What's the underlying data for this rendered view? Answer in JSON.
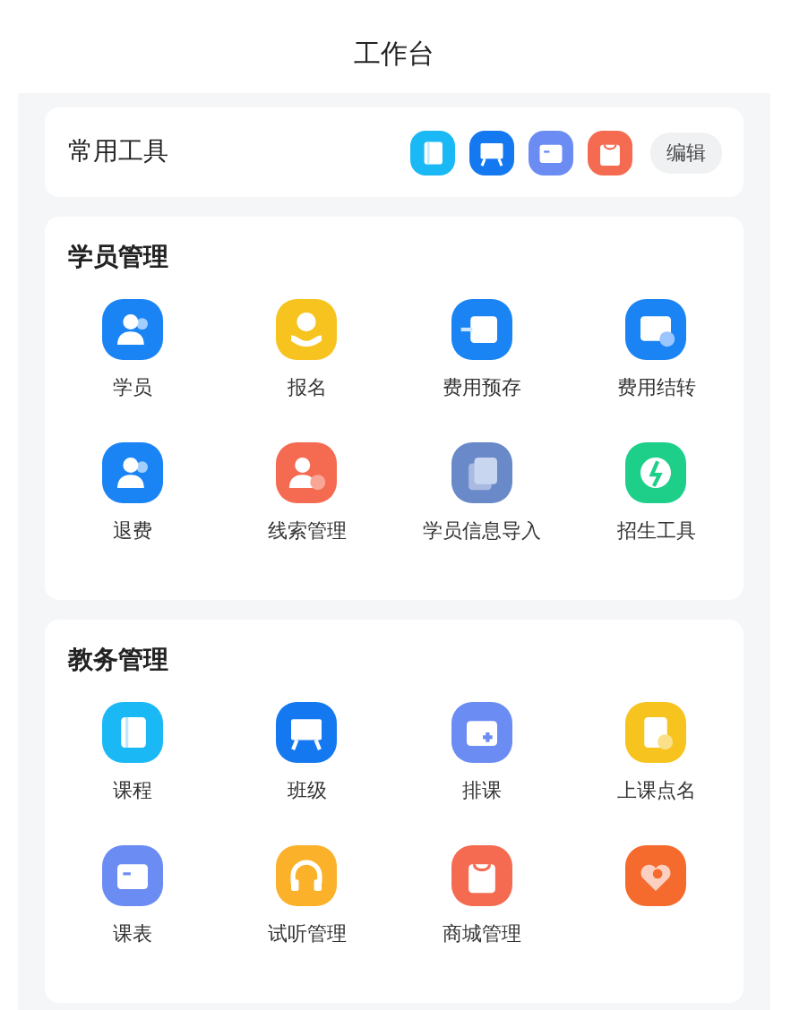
{
  "nav_bar": {
    "title": "工作台"
  },
  "quick_tools": {
    "title": "常用工具",
    "edit_button": "编辑",
    "tools": [
      {
        "kind": "book",
        "color": "#1ab8f5"
      },
      {
        "kind": "board",
        "color": "#1479f0"
      },
      {
        "kind": "calendar",
        "color": "#6b8cf2"
      },
      {
        "kind": "bag",
        "color": "#f56b52"
      }
    ]
  },
  "sections": [
    {
      "title": "学员管理",
      "items": [
        {
          "label": "学员",
          "kind": "person",
          "color": "#1a84f5"
        },
        {
          "label": "报名",
          "kind": "coin-hand",
          "color": "#f7c31e"
        },
        {
          "label": "费用预存",
          "kind": "arrow-card",
          "color": "#1a84f5"
        },
        {
          "label": "费用结转",
          "kind": "card-badge",
          "color": "#1a84f5"
        },
        {
          "label": "退费",
          "kind": "person",
          "color": "#1a84f5"
        },
        {
          "label": "线索管理",
          "kind": "person-phone",
          "color": "#f56b52"
        },
        {
          "label": "学员信息导入",
          "kind": "pages",
          "color": "#6a89c9"
        },
        {
          "label": "招生工具",
          "kind": "leaf",
          "color": "#1ecf8a"
        }
      ]
    },
    {
      "title": "教务管理",
      "items": [
        {
          "label": "课程",
          "kind": "book",
          "color": "#1ab8f5"
        },
        {
          "label": "班级",
          "kind": "board",
          "color": "#1479f0"
        },
        {
          "label": "排课",
          "kind": "calendar-plus",
          "color": "#6b8cf2"
        },
        {
          "label": "上课点名",
          "kind": "badge-check",
          "color": "#f7c31e"
        },
        {
          "label": "课表",
          "kind": "calendar",
          "color": "#6b8cf2"
        },
        {
          "label": "试听管理",
          "kind": "headphones",
          "color": "#fbb12a"
        },
        {
          "label": "商城管理",
          "kind": "bag",
          "color": "#f56b52"
        },
        {
          "kind": "heart-pin",
          "color": "#f56b2e"
        }
      ]
    }
  ]
}
